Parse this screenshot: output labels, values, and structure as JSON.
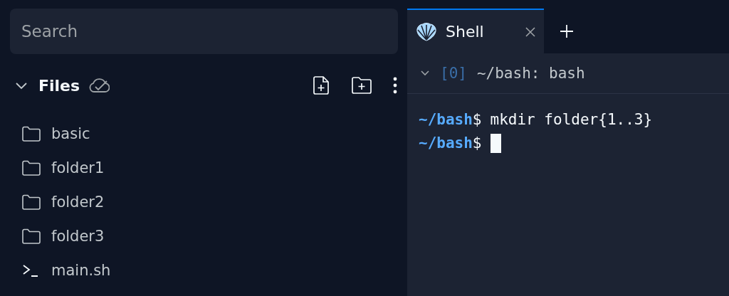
{
  "sidebar": {
    "search": {
      "placeholder": "Search"
    },
    "files_header": {
      "title": "Files",
      "expanded": true
    },
    "items": [
      {
        "kind": "folder",
        "name": "basic"
      },
      {
        "kind": "folder",
        "name": "folder1"
      },
      {
        "kind": "folder",
        "name": "folder2"
      },
      {
        "kind": "folder",
        "name": "folder3"
      },
      {
        "kind": "script",
        "name": "main.sh"
      }
    ]
  },
  "tabs": [
    {
      "label": "Shell",
      "selected": true
    }
  ],
  "session": {
    "expanded": true,
    "index": "[0]",
    "title": "~/bash: bash"
  },
  "terminal": {
    "lines": [
      {
        "prompt": "~/bash",
        "symbol": "$",
        "command": "mkdir folder{1..3}",
        "cursor": false
      },
      {
        "prompt": "~/bash",
        "symbol": "$",
        "cursor": true
      }
    ]
  }
}
